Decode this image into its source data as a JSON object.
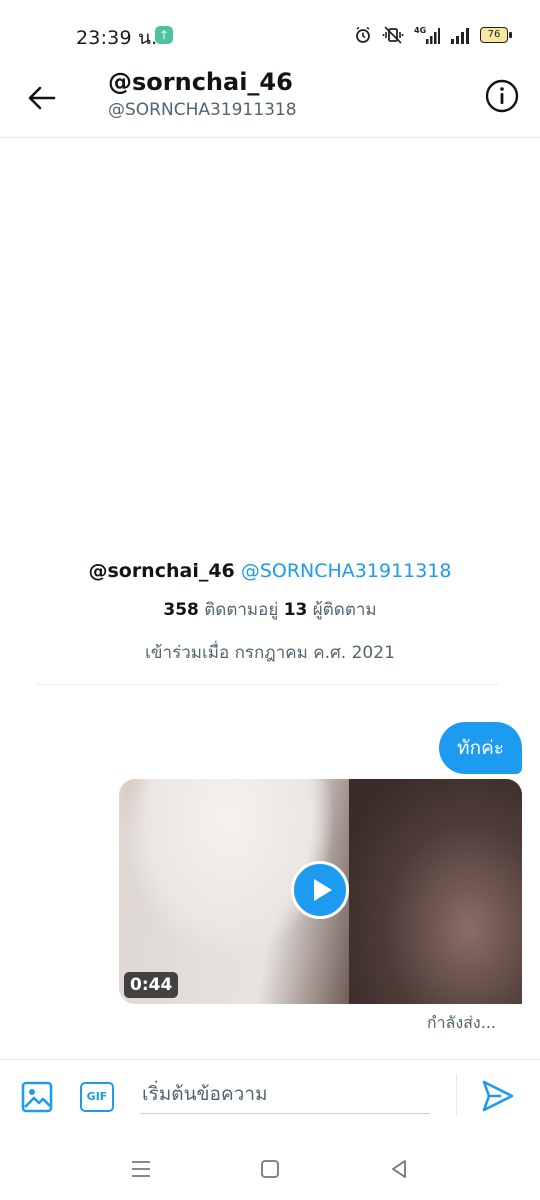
{
  "status_bar": {
    "time": "23:39 น.",
    "battery": "76",
    "network": "4G"
  },
  "header": {
    "title": "@sornchai_46",
    "subtitle": "@SORNCHA31911318"
  },
  "profile": {
    "name": "@sornchai_46",
    "handle": "@SORNCHA31911318",
    "following_count": "358",
    "following_label": "ติดตามอยู่",
    "followers_count": "13",
    "followers_label": "ผู้ติดตาม",
    "joined": "เข้าร่วมเมื่อ กรกฎาคม ค.ศ. 2021"
  },
  "messages": {
    "text_bubble": "ทักค่ะ",
    "video_duration": "0:44",
    "sending_status": "กำลังส่ง..."
  },
  "composer": {
    "gif_label": "GIF",
    "placeholder": "เริ่มต้นข้อความ"
  },
  "colors": {
    "accent": "#1d9bf0",
    "text_primary": "#0f1419",
    "text_secondary": "#536471"
  }
}
